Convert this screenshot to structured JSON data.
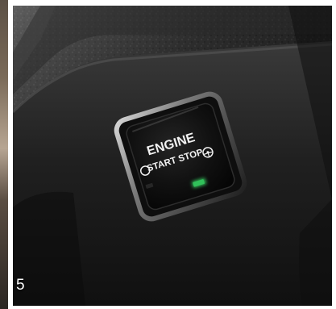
{
  "figure": {
    "slide_number": "5"
  },
  "button": {
    "line1": "ENGINE",
    "line2": "START STOP",
    "power_icon": "power-ring-icon",
    "steering_icon": "steering-wheel-icon"
  },
  "indicator": {
    "status_color": "#31c05a"
  }
}
